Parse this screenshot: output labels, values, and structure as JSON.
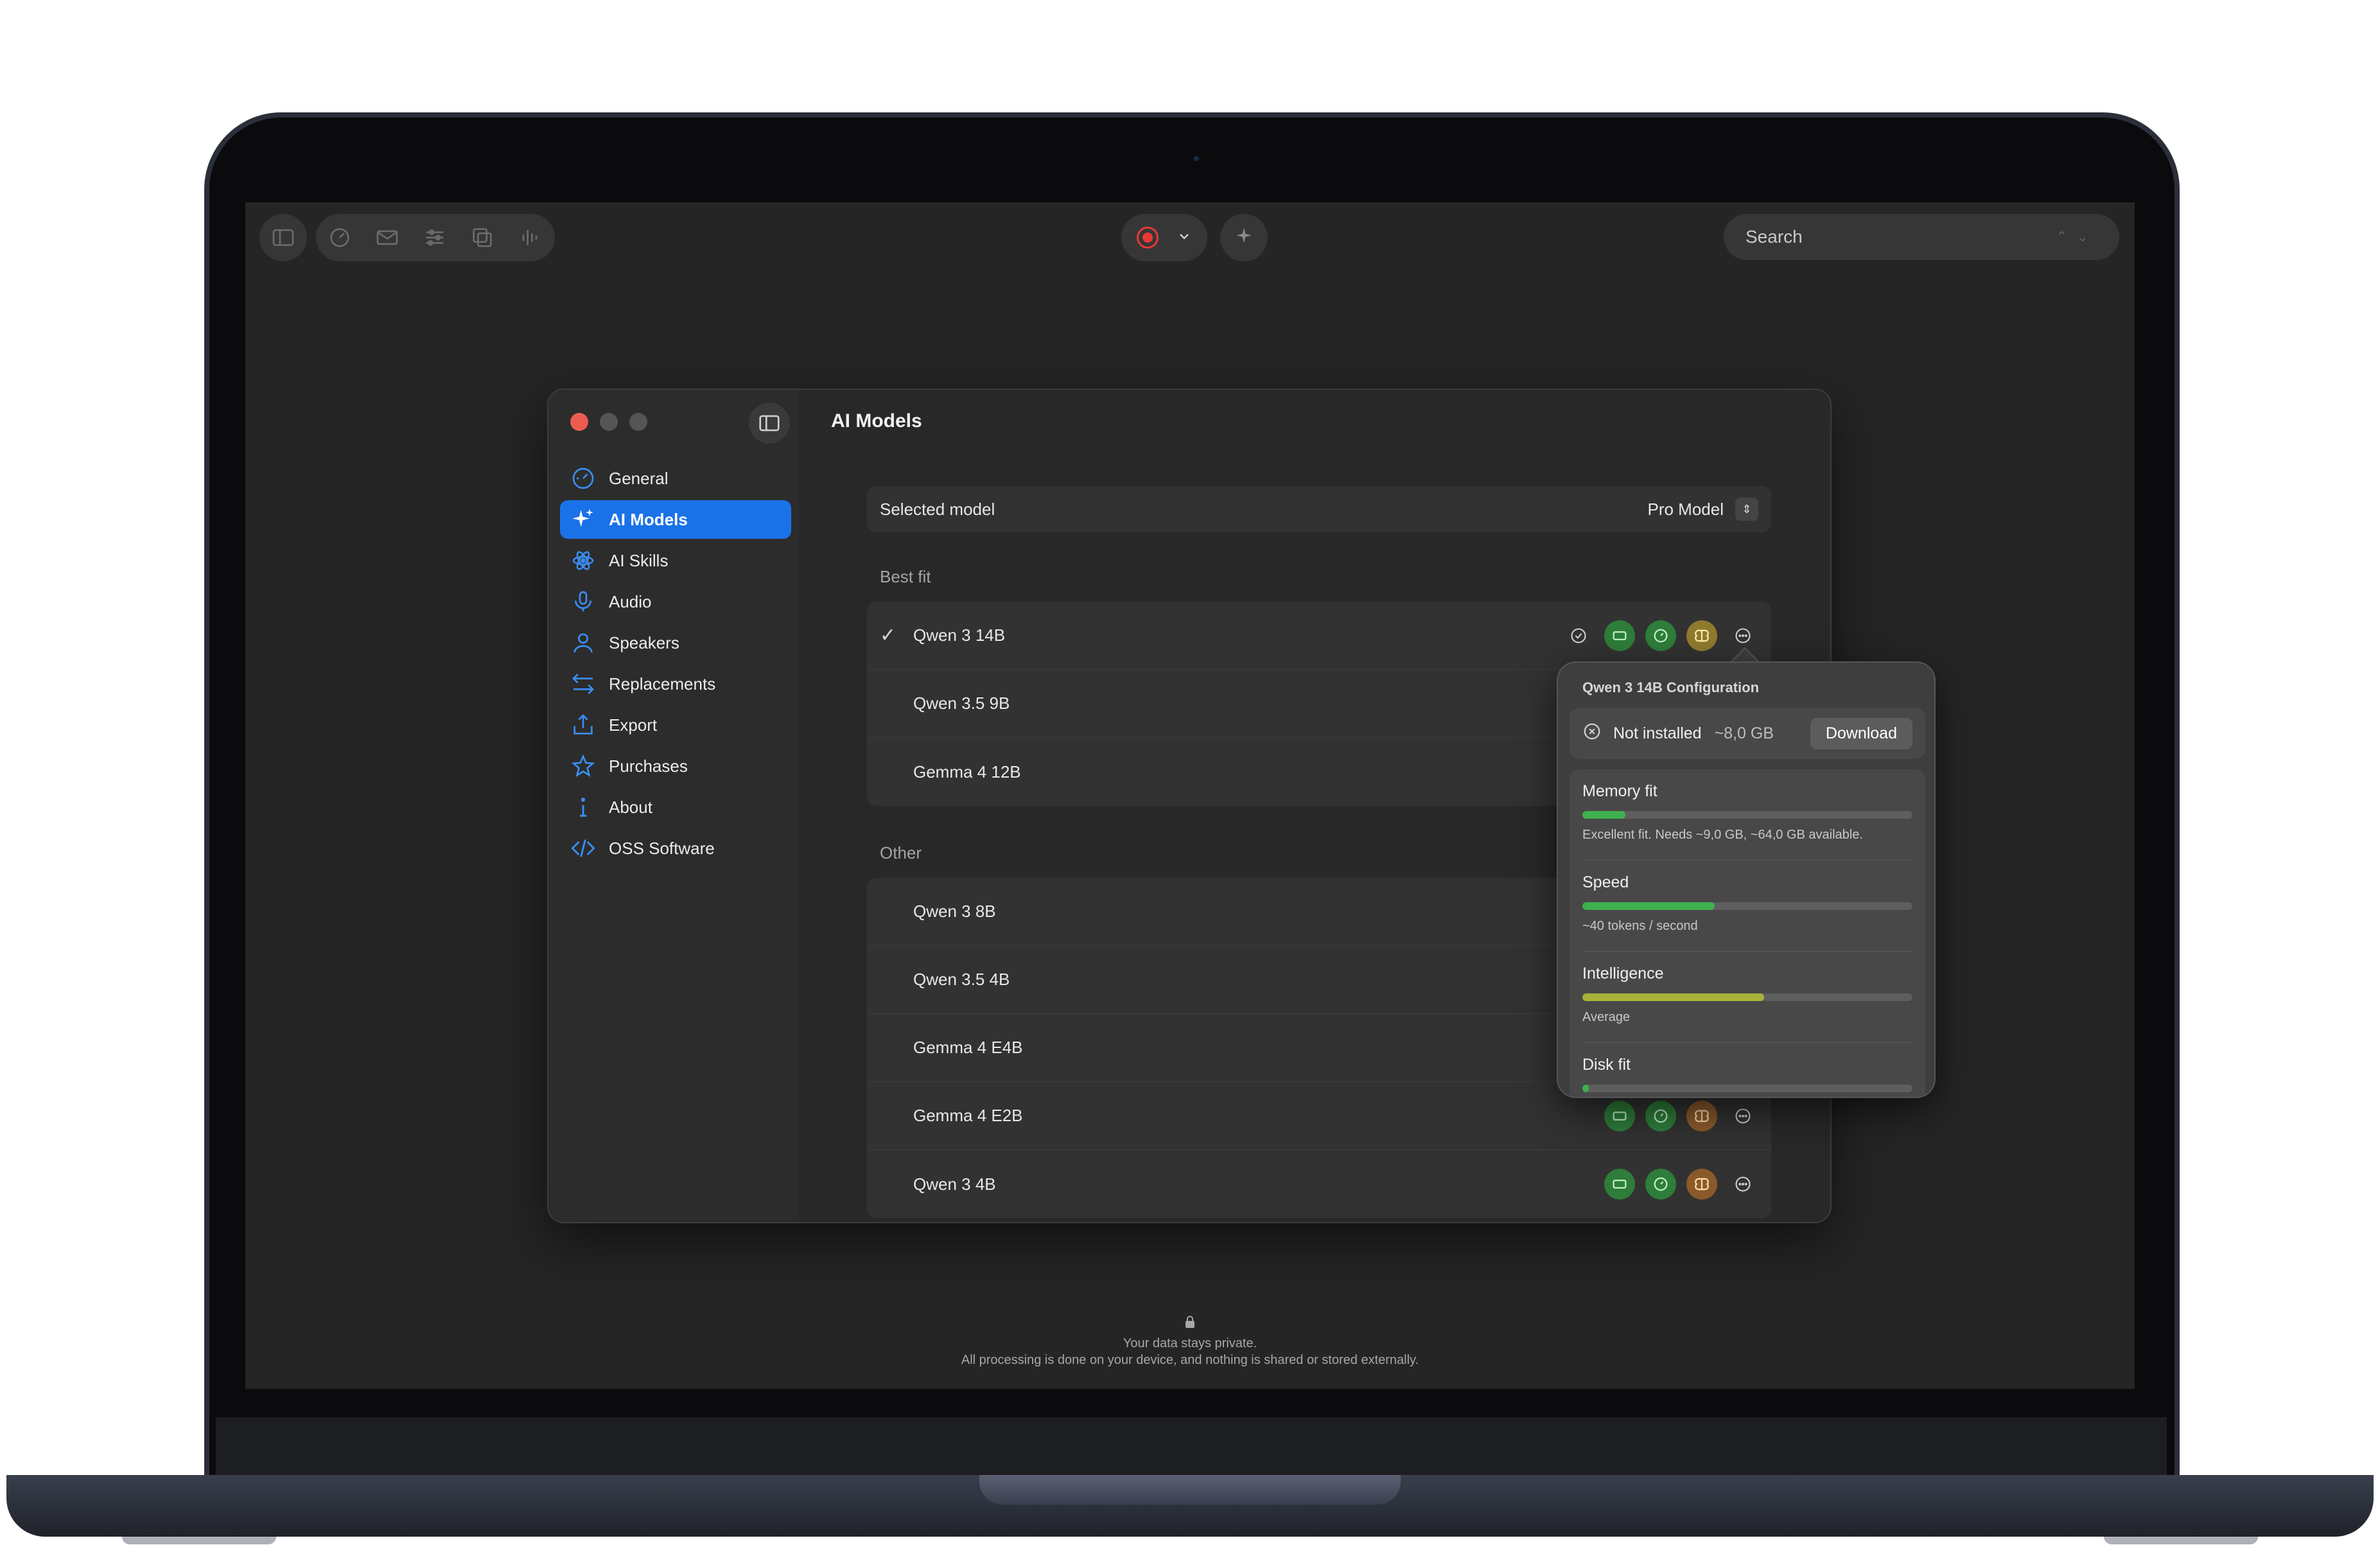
{
  "toolbar": {
    "left_icons": [
      "sidebar-icon",
      "dashboard-icon",
      "mail-icon",
      "sliders-icon",
      "copy-icon",
      "waveform-icon"
    ],
    "record_icon": "record-icon",
    "chevron_icon": "chevron-down-icon",
    "sparkle_icon": "sparkle-icon",
    "search_placeholder": "Search"
  },
  "window": {
    "title": "AI Models",
    "traffic_colors": [
      "#ec5d50",
      "#555555",
      "#555555"
    ]
  },
  "sidebar": {
    "items": [
      {
        "label": "General",
        "icon": "gauge-icon",
        "active": false
      },
      {
        "label": "AI Models",
        "icon": "sparkle-icon",
        "active": true
      },
      {
        "label": "AI Skills",
        "icon": "atom-icon",
        "active": false
      },
      {
        "label": "Audio",
        "icon": "microphone-icon",
        "active": false
      },
      {
        "label": "Speakers",
        "icon": "person-icon",
        "active": false
      },
      {
        "label": "Replacements",
        "icon": "arrows-swap-icon",
        "active": false
      },
      {
        "label": "Export",
        "icon": "export-icon",
        "active": false
      },
      {
        "label": "Purchases",
        "icon": "star-icon",
        "active": false
      },
      {
        "label": "About",
        "icon": "info-icon",
        "active": false
      },
      {
        "label": "OSS Software",
        "icon": "code-icon",
        "active": false
      }
    ]
  },
  "selected_model": {
    "label": "Selected model",
    "value": "Pro Model"
  },
  "best_fit": {
    "heading": "Best fit",
    "models": [
      {
        "name": "Qwen 3 14B",
        "checked": true
      },
      {
        "name": "Qwen 3.5 9B",
        "checked": false
      },
      {
        "name": "Gemma 4 12B",
        "checked": false
      }
    ]
  },
  "other": {
    "heading": "Other",
    "models": [
      {
        "name": "Qwen 3 8B"
      },
      {
        "name": "Qwen 3.5 4B"
      },
      {
        "name": "Gemma 4 E4B"
      },
      {
        "name": "Gemma 4 E2B"
      },
      {
        "name": "Qwen 3 4B"
      }
    ]
  },
  "popover": {
    "title": "Qwen 3 14B Configuration",
    "status": "Not installed",
    "size": "~8,0 GB",
    "download_label": "Download",
    "metrics": [
      {
        "label": "Memory fit",
        "level": 0.13,
        "color": "#3fb14f",
        "note": "Excellent fit. Needs ~9,0 GB, ~64,0 GB available."
      },
      {
        "label": "Speed",
        "level": 0.4,
        "color": "#3fb14f",
        "note": "~40 tokens / second"
      },
      {
        "label": "Intelligence",
        "level": 0.55,
        "color": "#a8b13a",
        "note": "Average"
      },
      {
        "label": "Disk fit",
        "level": 0.02,
        "color": "#3fb14f",
        "note": ""
      }
    ]
  },
  "footer": {
    "line1": "Your data stays private.",
    "line2": "All processing is done on your device, and nothing is shared or stored externally."
  },
  "colors": {
    "accent": "#1a72e8",
    "green_badge": "#2e7d3a",
    "orange_badge": "#8a5a2b",
    "record": "#e53935"
  }
}
